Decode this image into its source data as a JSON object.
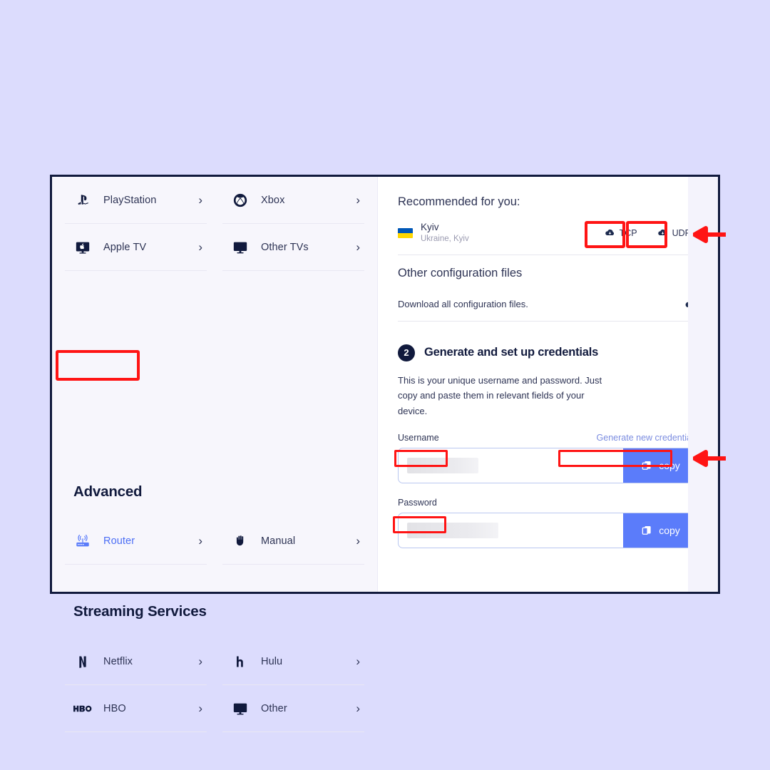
{
  "page": {
    "background_color": "#dcdcfd",
    "card_border_color": "#111a3d",
    "accent_blue": "#5b7cfa",
    "link_blue": "#7b8ce0",
    "annotation_color": "#ff1414"
  },
  "device_panel": {
    "top_rows": [
      {
        "label": "PlayStation",
        "icon": "playstation-icon",
        "chevron": "›"
      },
      {
        "label": "Xbox",
        "icon": "xbox-icon",
        "chevron": "›"
      },
      {
        "label": "Apple TV",
        "icon": "apple-tv-icon",
        "chevron": "›"
      },
      {
        "label": "Other TVs",
        "icon": "tv-icon",
        "chevron": "›"
      }
    ],
    "advanced_heading": "Advanced",
    "advanced_rows": [
      {
        "label": "Router",
        "icon": "router-icon",
        "chevron": "›"
      },
      {
        "label": "Manual",
        "icon": "hand-icon",
        "chevron": "›"
      }
    ],
    "streaming_heading": "Streaming Services",
    "streaming_rows": [
      {
        "label": "Netflix",
        "icon": "netflix-icon",
        "chevron": "›"
      },
      {
        "label": "Hulu",
        "icon": "hulu-icon",
        "chevron": "›"
      },
      {
        "label": "HBO",
        "icon": "hbo-icon",
        "chevron": "›"
      },
      {
        "label": "Other",
        "icon": "tv-icon",
        "chevron": "›"
      }
    ]
  },
  "config_panel": {
    "recommended_title": "Recommended for you:",
    "server": {
      "city": "Kyiv",
      "location": "Ukraine, Kyiv",
      "flag": "ukraine-flag"
    },
    "tcp_label": "TCP",
    "udp_label": "UDP",
    "other_config_title": "Other configuration files",
    "download_all_label": "Download all configuration files.",
    "step": {
      "number": "2",
      "title": "Generate and set up credentials",
      "description": "This is your unique username and password. Just copy and paste them in relevant fields of your device."
    },
    "username": {
      "label": "Username",
      "value": "",
      "copy_label": "copy"
    },
    "password": {
      "label": "Password",
      "value": "",
      "copy_label": "copy"
    },
    "generate_link": "Generate new credentials"
  }
}
